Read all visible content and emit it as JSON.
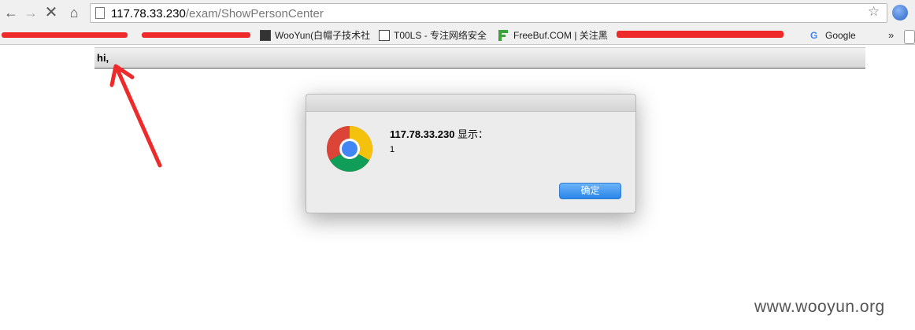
{
  "browser": {
    "url_host": "117.78.33.230",
    "url_path": "/exam/ShowPersonCenter",
    "bookmarks": [
      {
        "label": "WooYun(白帽子技术社",
        "icon": "wooyun-icon"
      },
      {
        "label": "T00LS - 专注网络安全",
        "icon": "t00ls-icon"
      },
      {
        "label": "FreeBuf.COM | 关注黑",
        "icon": "freebuf-icon"
      },
      {
        "label": "Google",
        "icon": "google-icon"
      }
    ],
    "more_label": "»"
  },
  "page": {
    "greeting": "hi,"
  },
  "alert": {
    "origin": "117.78.33.230",
    "says": " 显示：",
    "message": "1",
    "ok_label": "确定"
  },
  "watermark": "www.wooyun.org",
  "colors": {
    "annotation_red": "#ef2a2a",
    "ok_button": "#2a86ea"
  }
}
